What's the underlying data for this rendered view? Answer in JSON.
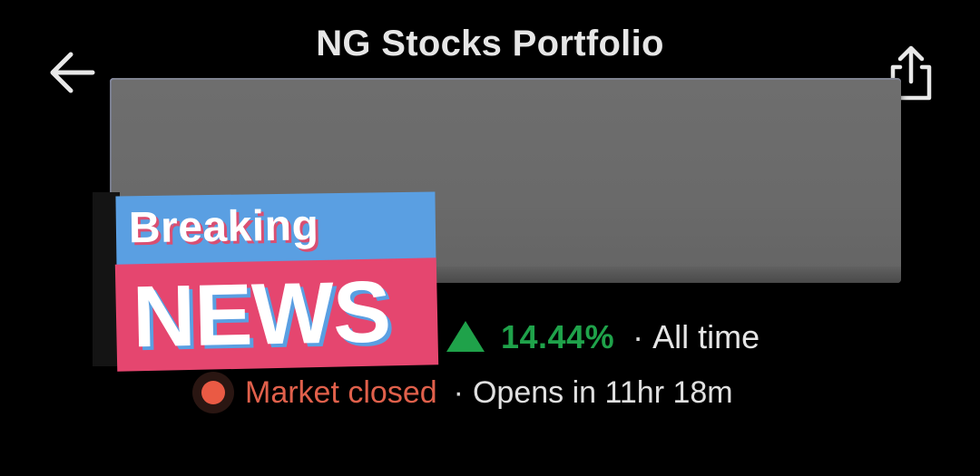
{
  "header": {
    "title": "NG Stocks Portfolio",
    "back_icon": "arrow-left-icon",
    "share_icon": "share-icon"
  },
  "overlay": {
    "breaking_label": "Breaking",
    "news_label": "NEWS",
    "colors": {
      "breaking_bg": "#5a9fe2",
      "news_bg": "#e5466f",
      "box_bg": "#6a6a6a"
    }
  },
  "performance": {
    "direction_icon": "triangle-up-icon",
    "change_percent": "14.44%",
    "separator": "·",
    "period": "All time",
    "color": "#1fa24a"
  },
  "market": {
    "status_icon": "status-dot-icon",
    "status": "Market closed",
    "separator": "·",
    "opens_text": "Opens in 11hr 18m",
    "status_color": "#e0604b"
  }
}
